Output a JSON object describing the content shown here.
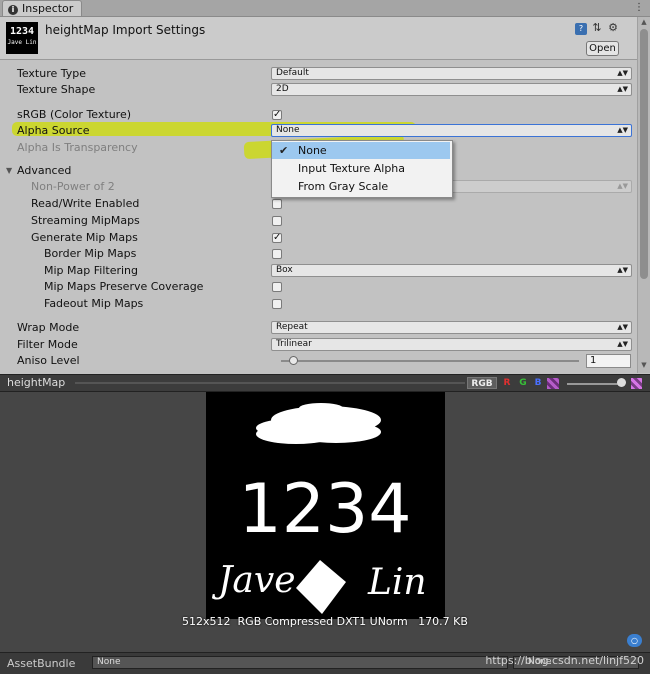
{
  "window": {
    "tab_label": "Inspector",
    "tab_icon": "info-icon"
  },
  "header": {
    "thumb_number": "1234",
    "thumb_signature": "Jave Lin",
    "title": "heightMap Import Settings",
    "open_label": "Open",
    "icons": [
      "help-book-icon",
      "preset-sliders-icon",
      "gear-icon"
    ]
  },
  "settings": {
    "texture_type": {
      "label": "Texture Type",
      "value": "Default"
    },
    "texture_shape": {
      "label": "Texture Shape",
      "value": "2D"
    },
    "srgb": {
      "label": "sRGB (Color Texture)",
      "checked": true
    },
    "alpha_source": {
      "label": "Alpha Source",
      "value": "None"
    },
    "alpha_is_transparency": {
      "label": "Alpha Is Transparency"
    },
    "advanced": {
      "label": "Advanced"
    },
    "non_power_of_2": {
      "label": "Non-Power of 2"
    },
    "read_write": {
      "label": "Read/Write Enabled",
      "checked": false
    },
    "streaming_mipmaps": {
      "label": "Streaming MipMaps",
      "checked": false
    },
    "generate_mip_maps": {
      "label": "Generate Mip Maps",
      "checked": true
    },
    "border_mip_maps": {
      "label": "Border Mip Maps",
      "checked": false
    },
    "mip_map_filtering": {
      "label": "Mip Map Filtering",
      "value": "Box"
    },
    "mip_maps_preserve_coverage": {
      "label": "Mip Maps Preserve Coverage",
      "checked": false
    },
    "fadeout_mip_maps": {
      "label": "Fadeout Mip Maps",
      "checked": false
    },
    "wrap_mode": {
      "label": "Wrap Mode",
      "value": "Repeat"
    },
    "filter_mode": {
      "label": "Filter Mode",
      "value": "Trilinear"
    },
    "aniso_level": {
      "label": "Aniso Level",
      "value": "1",
      "fraction": 0.0
    }
  },
  "alpha_source_popup": {
    "items": [
      "None",
      "Input Texture Alpha",
      "From Gray Scale"
    ],
    "selected": "None"
  },
  "preview": {
    "title": "heightMap",
    "channels": {
      "rgb": "RGB",
      "r": "R",
      "g": "G",
      "b": "B"
    },
    "mip_icon": "mip-level-icon",
    "alpha_icon": "alpha-checker-icon",
    "texture_text_number": "1234",
    "texture_text_name_left": "Jave",
    "texture_text_name_right": "Lin",
    "info": "512x512  RGB Compressed DXT1 UNorm   170.7 KB",
    "tag_icon": "label-tag-icon"
  },
  "asset_bundle": {
    "label": "AssetBundle",
    "value": "None",
    "variant": "None"
  },
  "watermark": "https://blog.csdn.net/linjf520",
  "colors": {
    "highlight": "#cedc00",
    "popup_selected": "#9cc8ef",
    "preview_bg": "#464646"
  }
}
